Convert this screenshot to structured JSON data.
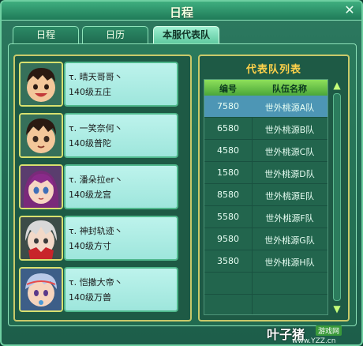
{
  "window": {
    "title": "日程",
    "close_label": "✕"
  },
  "tabs": [
    {
      "label": "日程"
    },
    {
      "label": "日历"
    },
    {
      "label": "本服代表队",
      "active": true
    }
  ],
  "members": [
    {
      "name": "τ. 晴天哥哥丶",
      "level": "140级五庄"
    },
    {
      "name": "τ. 一笑奈何丶",
      "level": "140级普陀"
    },
    {
      "name": "τ. 潘朵拉er丶",
      "level": "140级龙宫"
    },
    {
      "name": "τ. 神封轨迹丶",
      "level": "140级方寸"
    },
    {
      "name": "τ. 恺撒大帝丶",
      "level": "140级万兽"
    }
  ],
  "team_list": {
    "title": "代表队列表",
    "columns": [
      "编号",
      "队伍名称"
    ],
    "rows": [
      {
        "id": "7580",
        "team": "世外桃源A队",
        "selected": true
      },
      {
        "id": "6580",
        "team": "世外桃源B队"
      },
      {
        "id": "4580",
        "team": "世外桃源C队"
      },
      {
        "id": "1580",
        "team": "世外桃源D队"
      },
      {
        "id": "8580",
        "team": "世外桃源E队"
      },
      {
        "id": "5580",
        "team": "世外桃源F队"
      },
      {
        "id": "9580",
        "team": "世外桃源G队"
      },
      {
        "id": "3580",
        "team": "世外桃源H队"
      }
    ]
  },
  "watermark": {
    "main": "叶子猪",
    "tag": "游戏网",
    "url": "www.YZZ.cn"
  },
  "colors": {
    "list_title": "#ffd24a",
    "selected_row": "#4d96b5",
    "header": "#6cc84a"
  }
}
